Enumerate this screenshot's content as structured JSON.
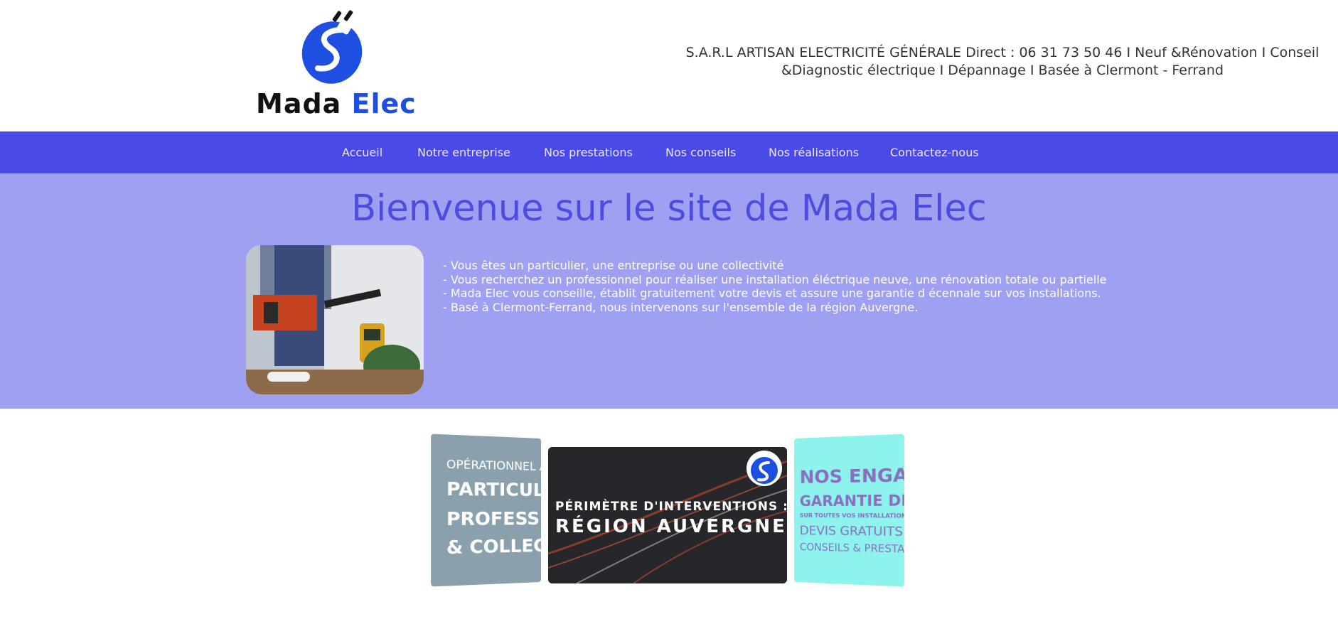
{
  "header": {
    "logo": {
      "word1": "Mada",
      "word2": "Elec"
    },
    "tagline_line1": "S.A.R.L ARTISAN ELECTRICITÉ GÉNÉRALE Direct : 06 31 73 50 46 I Neuf &Rénovation I Conseil",
    "tagline_line2": "&Diagnostic électrique I Dépannage I Basée à Clermont - Ferrand"
  },
  "nav": {
    "items": [
      {
        "label": "Accueil"
      },
      {
        "label": "Notre entreprise"
      },
      {
        "label": "Nos prestations"
      },
      {
        "label": "Nos conseils"
      },
      {
        "label": "Nos réalisations"
      },
      {
        "label": "Contactez-nous"
      }
    ]
  },
  "hero": {
    "title": "Bienvenue sur le site de Mada Elec",
    "lines": [
      "- Vous êtes un particulier, une entreprise ou une collectivité",
      "- Vous recherchez un professionnel pour réaliser une installation éléctrique neuve, une rénovation totale ou partielle",
      "- Mada Elec vous  conseille, établit gratuitement votre devis et assure  une garantie d écennale sur vos installations.",
      "- Basé à Clermont-Ferrand, nous intervenons sur l'ensemble de la région Auvergne."
    ]
  },
  "cards": {
    "left": {
      "line1": "OPÉRATIONNEL A",
      "line2": "PARTICULI",
      "line3": "PROFESSIO",
      "line4": "& COLLEC"
    },
    "middle": {
      "line1": "PÉRIMÈTRE D'INTERVENTIONS :",
      "line2": "RÉGION AUVERGNE"
    },
    "right": {
      "line1": "NOS ENGAG",
      "line2": "GARANTIE DÉ",
      "line3": "SUR TOUTES VOS INSTALLATIONS",
      "line4": "DEVIS GRATUITS &",
      "line5": "CONSEILS & PRESTA"
    }
  },
  "colors": {
    "nav_bg": "#4a4ae8",
    "hero_bg": "#a0a0f2",
    "brand_blue": "#1e4fe0",
    "title_color": "#4c4ce0"
  }
}
